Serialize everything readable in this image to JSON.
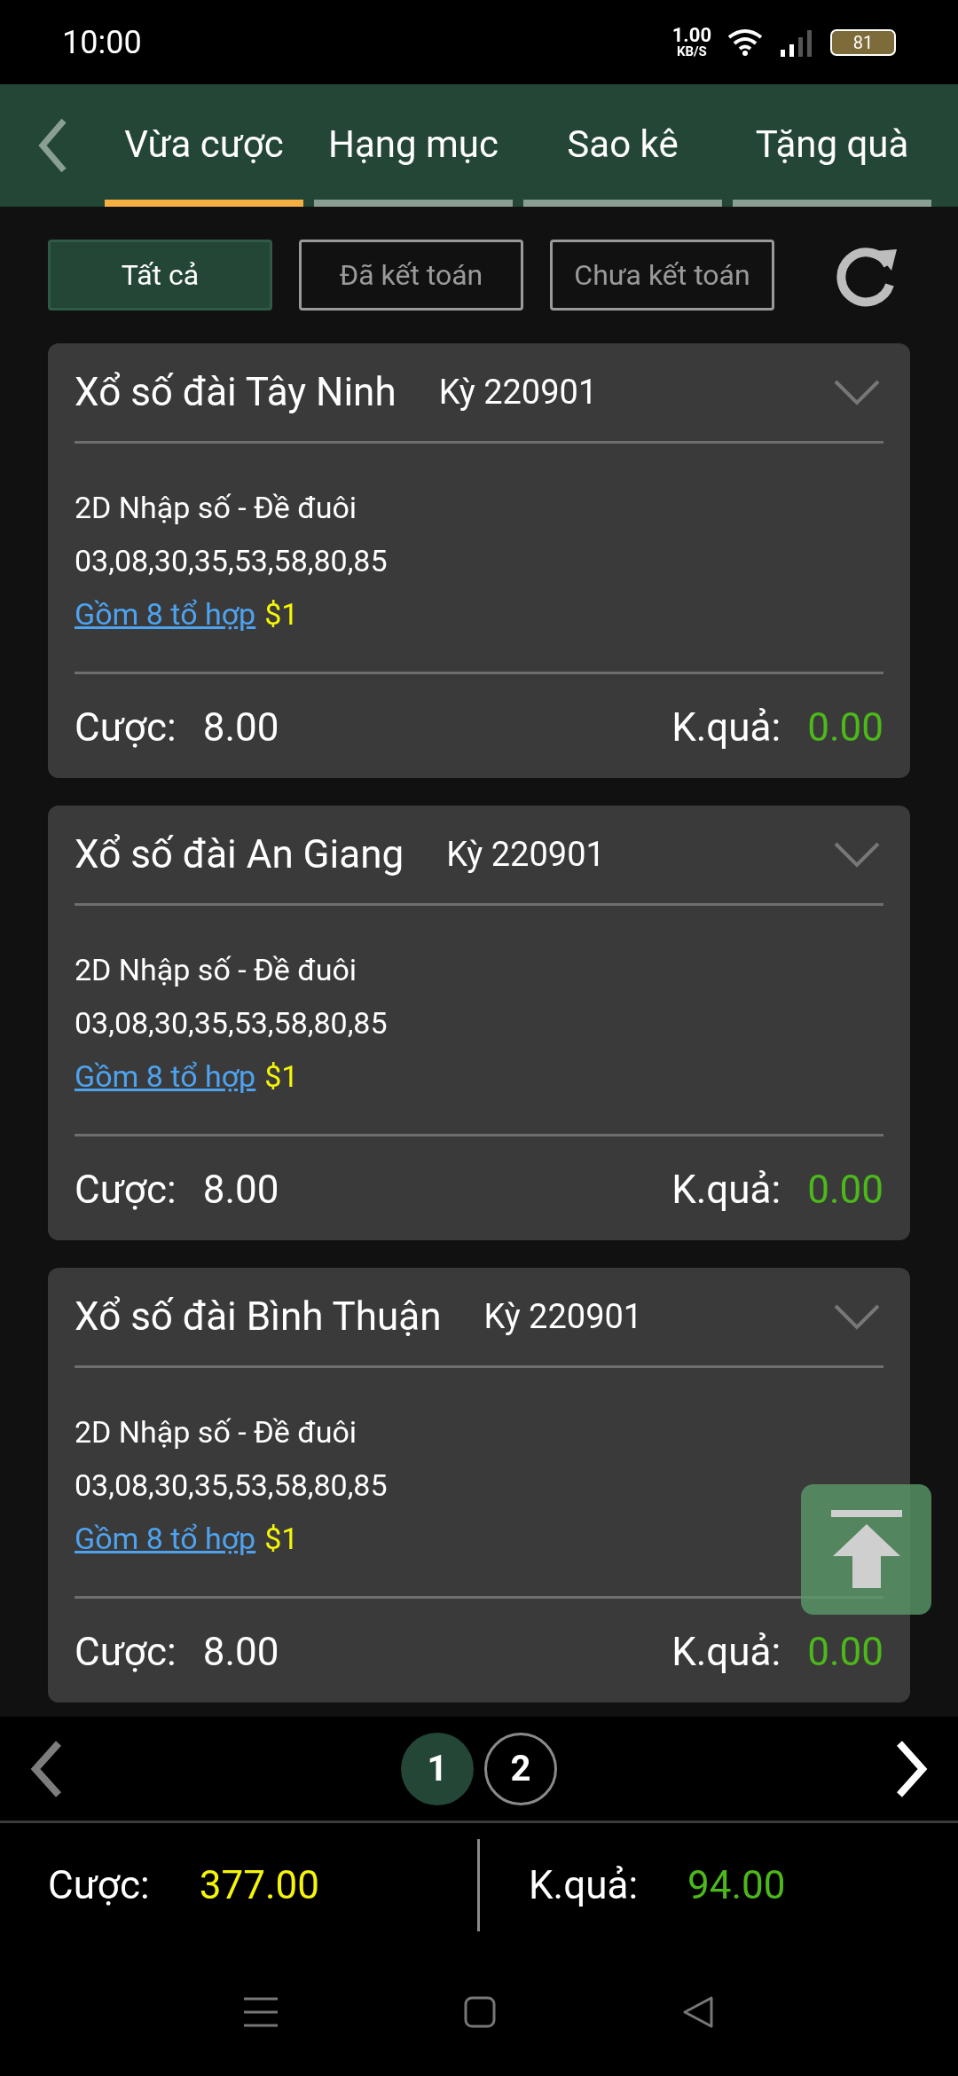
{
  "status_bar": {
    "time": "10:00",
    "net_speed": "1.00",
    "net_unit": "KB/S",
    "battery": "81"
  },
  "tabs": [
    {
      "label": "Vừa cược",
      "selected": true
    },
    {
      "label": "Hạng mục",
      "selected": false
    },
    {
      "label": "Sao kê",
      "selected": false
    },
    {
      "label": "Tặng quà",
      "selected": false
    }
  ],
  "filters": [
    {
      "label": "Tất cả",
      "selected": true
    },
    {
      "label": "Đã kết toán",
      "selected": false
    },
    {
      "label": "Chưa kết toán",
      "selected": false
    }
  ],
  "cards": [
    {
      "title": "Xổ số đài Tây Ninh",
      "period": "Kỳ 220901",
      "bet_type": "2D Nhập số - Đề đuôi",
      "numbers": "03,08,30,35,53,58,80,85",
      "combo_link": "Gồm 8 tổ hợp",
      "unit": "$1",
      "bet_label": "Cược:",
      "bet_value": "8.00",
      "result_label": "K.quả:",
      "result_value": "0.00"
    },
    {
      "title": "Xổ số đài An Giang",
      "period": "Kỳ 220901",
      "bet_type": "2D Nhập số - Đề đuôi",
      "numbers": "03,08,30,35,53,58,80,85",
      "combo_link": "Gồm 8 tổ hợp",
      "unit": "$1",
      "bet_label": "Cược:",
      "bet_value": "8.00",
      "result_label": "K.quả:",
      "result_value": "0.00"
    },
    {
      "title": "Xổ số đài Bình Thuận",
      "period": "Kỳ 220901",
      "bet_type": "2D Nhập số - Đề đuôi",
      "numbers": "03,08,30,35,53,58,80,85",
      "combo_link": "Gồm 8 tổ hợp",
      "unit": "$1",
      "bet_label": "Cược:",
      "bet_value": "8.00",
      "result_label": "K.quả:",
      "result_value": "0.00"
    }
  ],
  "pagination": {
    "prev_disabled": true,
    "next_disabled": false,
    "pages": [
      {
        "label": "1",
        "selected": true
      },
      {
        "label": "2",
        "selected": false
      }
    ]
  },
  "summary": {
    "bet_label": "Cược:",
    "bet_value": "377.00",
    "result_label": "K.quả:",
    "result_value": "94.00"
  }
}
